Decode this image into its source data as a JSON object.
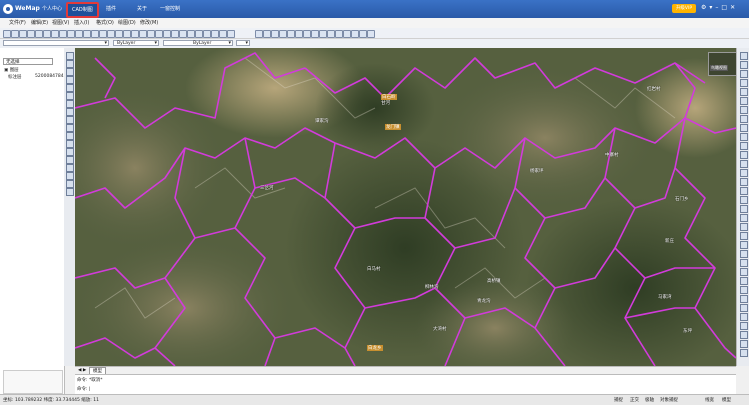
{
  "app": {
    "name": "WeMap"
  },
  "tabs": [
    {
      "label": "个人中心",
      "active": false
    },
    {
      "label": "CAD制图",
      "active": true
    },
    {
      "label": "插件",
      "active": false
    },
    {
      "label": "关于",
      "active": false
    },
    {
      "label": "一窗控制",
      "active": false
    }
  ],
  "title_actions": {
    "vip_label": "升级VIP"
  },
  "menu": [
    "文件(F)",
    "编辑(E)",
    "视图(V)",
    "插入(I)",
    "格式(O)",
    "绘图(D)",
    "修改(M)"
  ],
  "style_bar": {
    "color_value": "ByLayer",
    "layer_value": "ByLayer",
    "linetype_value": "ByLayer"
  },
  "layers": {
    "selector": "无选择",
    "rows": [
      {
        "label": "图层"
      },
      {
        "label": "标注层",
        "value": "5200084784"
      }
    ]
  },
  "map": {
    "overview_label": "鸟瞰视图",
    "places": [
      {
        "name": "谭家沟"
      },
      {
        "name": "甘河"
      },
      {
        "name": "三岔河"
      },
      {
        "name": "中寨村"
      },
      {
        "name": "杨家坪"
      },
      {
        "name": "石门乡"
      },
      {
        "name": "高桥镇"
      },
      {
        "name": "白马村"
      },
      {
        "name": "柳林沟"
      },
      {
        "name": "青龙沟"
      },
      {
        "name": "大湾村"
      },
      {
        "name": "新庄"
      },
      {
        "name": "马家湾"
      },
      {
        "name": "东坪"
      },
      {
        "name": "红岩村"
      }
    ],
    "badges": [
      "白石岭",
      "龙门镇",
      "白龙乡"
    ]
  },
  "bottom_tabs": [
    "模型"
  ],
  "command": {
    "line1_prefix": "命令:",
    "line1_text": "*取消*",
    "line2_prefix": "命令:"
  },
  "status": {
    "coords": "坐标: 103.789232 纬度: 33.734445 缩放: 11",
    "buttons": [
      "捕捉",
      "正交",
      "极轴",
      "对象捕捉",
      "线宽",
      "模型"
    ]
  }
}
